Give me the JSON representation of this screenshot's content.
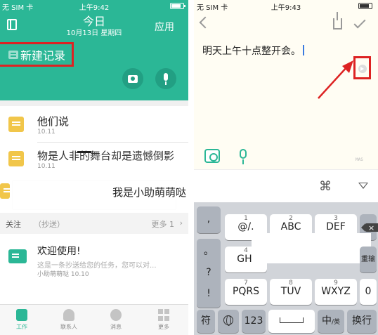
{
  "left_panel": {
    "status": {
      "carrier": "无 SIM 卡",
      "time": "上午9:42"
    },
    "header": {
      "title": "今日",
      "date": "10月13日 星期四",
      "app_button": "应用"
    },
    "new_record_label": "新建记录",
    "items": [
      {
        "title": "他们说",
        "date": "10.11"
      },
      {
        "title": "物是人非的舞台却是遗憾倒影",
        "date": "10.11"
      },
      {
        "title": "我是小助萌萌哒"
      }
    ],
    "section": {
      "title": "关注",
      "subtitle": "（抄送）",
      "more": "更多 1"
    },
    "welcome": {
      "title": "欢迎使用!",
      "desc": "这是一条抄送给您的任务，您可以对...",
      "meta": "小助萌萌哒  10.10"
    },
    "tabs": [
      {
        "label": "工作",
        "icon": "work-icon"
      },
      {
        "label": "联系人",
        "icon": "contacts-icon"
      },
      {
        "label": "消息",
        "icon": "message-icon"
      },
      {
        "label": "更多",
        "icon": "more-grid-icon"
      }
    ]
  },
  "right_panel": {
    "status": {
      "carrier": "无 SIM 卡",
      "time": "上午9:43"
    },
    "editor_text": "明天上午十点整开会。",
    "watermark": "MAS",
    "keyboard": {
      "col1": [
        ",",
        "。",
        "?",
        "!"
      ],
      "row1": [
        {
          "main": "@/.",
          "sub": "1"
        },
        {
          "main": "ABC",
          "sub": "2"
        },
        {
          "main": "DEF",
          "sub": "3"
        }
      ],
      "row2": [
        {
          "main": "GHI",
          "sub": "4"
        }
      ],
      "row2_right": {
        "main": "重输",
        "sub": ""
      },
      "row3": [
        {
          "main": "PQRS",
          "sub": "7"
        },
        {
          "main": "TUV",
          "sub": "8"
        },
        {
          "main": "WXYZ",
          "sub": "9"
        },
        {
          "main": "0",
          "sub": ""
        }
      ],
      "bottom": {
        "fu": "符",
        "num": "123",
        "zhong": "中",
        "ying": "/英",
        "return": "换行"
      }
    }
  },
  "colors": {
    "brand_green": "#2bb796",
    "annotation_red": "#dd2222"
  }
}
